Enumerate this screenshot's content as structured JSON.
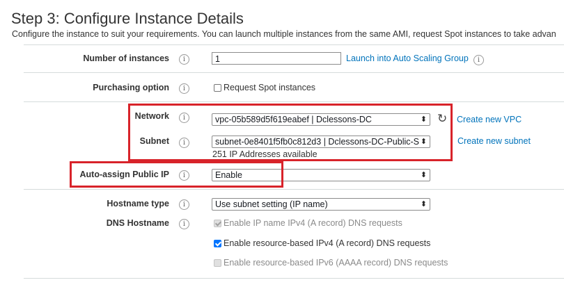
{
  "header": {
    "title": "Step 3: Configure Instance Details",
    "subtitle": "Configure the instance to suit your requirements. You can launch multiple instances from the same AMI, request Spot instances to take advan"
  },
  "info_glyph": "i",
  "instances": {
    "label": "Number of instances",
    "value": "1",
    "link": "Launch into Auto Scaling Group"
  },
  "purchasing": {
    "label": "Purchasing option",
    "checkbox_label": "Request Spot instances",
    "checked": false
  },
  "network": {
    "label": "Network",
    "value": "vpc-05b589d5f619eabef | Dclessons-DC",
    "link": "Create new VPC",
    "refresh_icon": "refresh-icon"
  },
  "subnet": {
    "label": "Subnet",
    "value": "subnet-0e8401f5fb0c812d3 | Dclessons-DC-Public-S",
    "available": "251 IP Addresses available",
    "link": "Create new subnet"
  },
  "public_ip": {
    "label": "Auto-assign Public IP",
    "value": "Enable"
  },
  "hostname": {
    "label": "Hostname type",
    "value": "Use subnet setting (IP name)"
  },
  "dns": {
    "label": "DNS Hostname",
    "options": [
      {
        "label": "Enable IP name IPv4 (A record) DNS requests",
        "checked": true,
        "disabled": true
      },
      {
        "label": "Enable resource-based IPv4 (A record) DNS requests",
        "checked": true,
        "disabled": false
      },
      {
        "label": "Enable resource-based IPv6 (AAAA record) DNS requests",
        "checked": false,
        "disabled": true
      }
    ]
  },
  "colors": {
    "link": "#0073bb",
    "highlight": "#d8232a",
    "divider": "#d5dbdb"
  }
}
